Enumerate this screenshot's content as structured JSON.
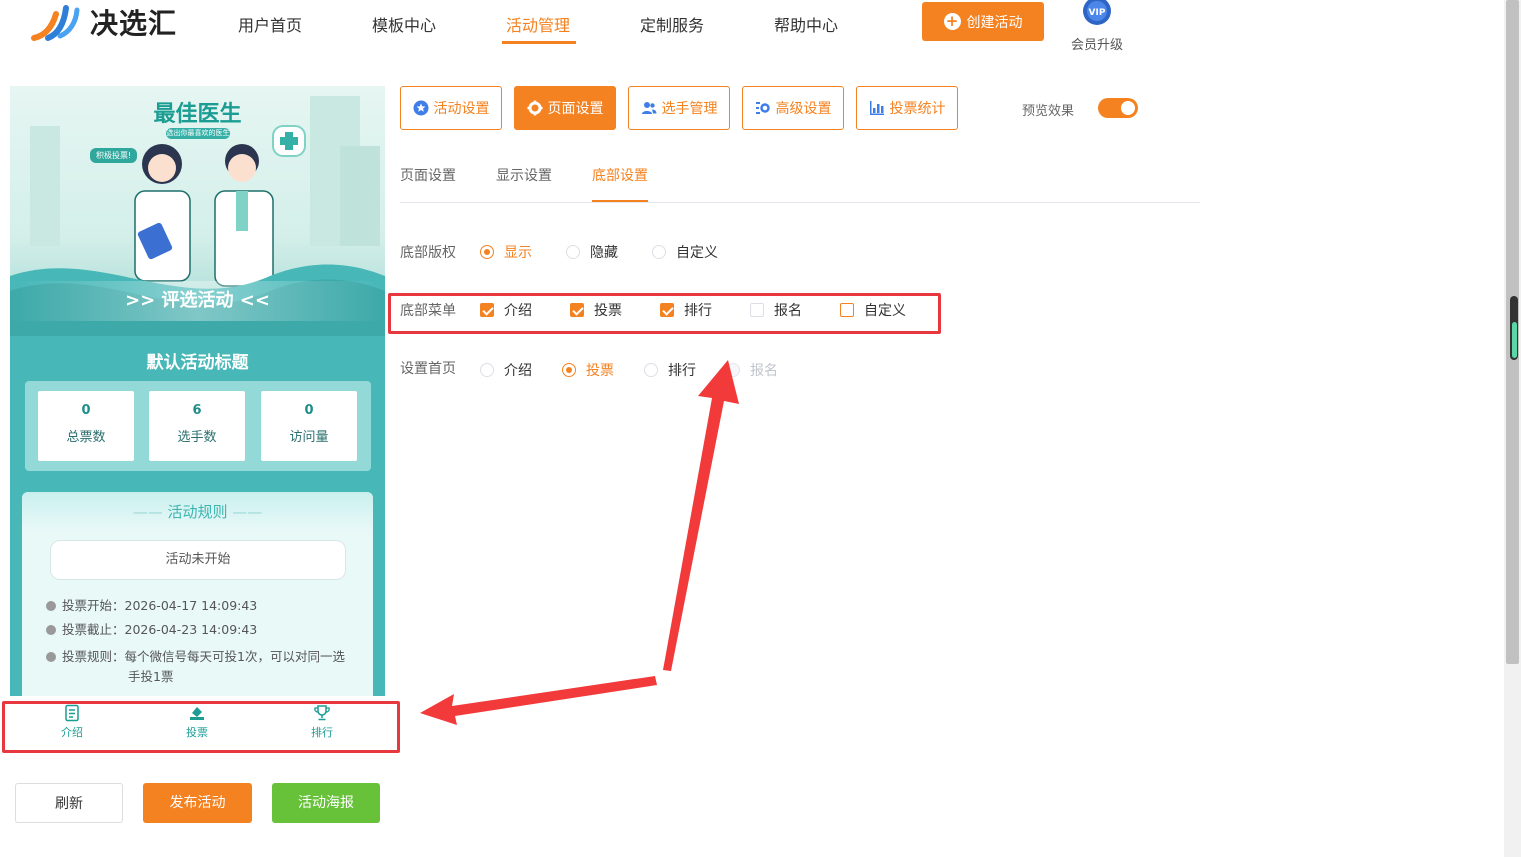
{
  "brand": {
    "name": "决选汇"
  },
  "nav": {
    "items": [
      {
        "label": "用户首页",
        "active": false
      },
      {
        "label": "模板中心",
        "active": false
      },
      {
        "label": "活动管理",
        "active": true
      },
      {
        "label": "定制服务",
        "active": false
      },
      {
        "label": "帮助中心",
        "active": false
      }
    ],
    "create_label": "创建活动",
    "vip_badge": "VIP",
    "vip_label": "会员升级"
  },
  "preview": {
    "banner_title": "最佳医生",
    "banner_subtitle": "选出你最喜欢的医生",
    "banner_bubble": "积极投票!",
    "banner_bar": ">> 评选活动 <<",
    "activity_title": "默认活动标题",
    "stats": [
      {
        "value": "0",
        "label": "总票数"
      },
      {
        "value": "6",
        "label": "选手数"
      },
      {
        "value": "0",
        "label": "访问量"
      }
    ],
    "rules": {
      "heading": "活动规则",
      "status": "活动未开始",
      "vote_start": "投票开始：2026-04-17 14:09:43",
      "vote_end": "投票截止：2026-04-23 14:09:43",
      "vote_rule": "投票规则：每个微信号每天可投1次，可以对同一选手投1票"
    },
    "tabbar": [
      {
        "label": "介绍",
        "icon": "document-icon"
      },
      {
        "label": "投票",
        "icon": "vote-icon"
      },
      {
        "label": "排行",
        "icon": "trophy-icon"
      }
    ]
  },
  "actions": {
    "refresh": "刷新",
    "publish": "发布活动",
    "poster": "活动海报"
  },
  "toolbar": {
    "buttons": [
      {
        "label": "活动设置",
        "icon": "star-icon",
        "active": false
      },
      {
        "label": "页面设置",
        "icon": "gear-icon",
        "active": true
      },
      {
        "label": "选手管理",
        "icon": "users-icon",
        "active": false
      },
      {
        "label": "高级设置",
        "icon": "settings-icon",
        "active": false
      },
      {
        "label": "投票统计",
        "icon": "bar-chart-icon",
        "active": false
      }
    ],
    "preview_label": "预览效果",
    "preview_on": true
  },
  "subtabs": [
    {
      "label": "页面设置",
      "active": false
    },
    {
      "label": "显示设置",
      "active": false
    },
    {
      "label": "底部设置",
      "active": true
    }
  ],
  "form": {
    "copyright": {
      "label": "底部版权",
      "options": [
        "显示",
        "隐藏",
        "自定义"
      ],
      "selected": "显示"
    },
    "bottom_menu": {
      "label": "底部菜单",
      "options": [
        {
          "label": "介绍",
          "checked": true
        },
        {
          "label": "投票",
          "checked": true
        },
        {
          "label": "排行",
          "checked": true
        },
        {
          "label": "报名",
          "checked": false
        },
        {
          "label": "自定义",
          "checked": false
        }
      ]
    },
    "home_page": {
      "label": "设置首页",
      "options": [
        {
          "label": "介绍",
          "disabled": false
        },
        {
          "label": "投票",
          "disabled": false
        },
        {
          "label": "排行",
          "disabled": false
        },
        {
          "label": "报名",
          "disabled": true
        }
      ],
      "selected": "投票"
    }
  },
  "colors": {
    "accent": "#f58220",
    "annotation_red": "#e8383f",
    "preview_teal": "#47b7b7",
    "success": "#67c23a"
  }
}
